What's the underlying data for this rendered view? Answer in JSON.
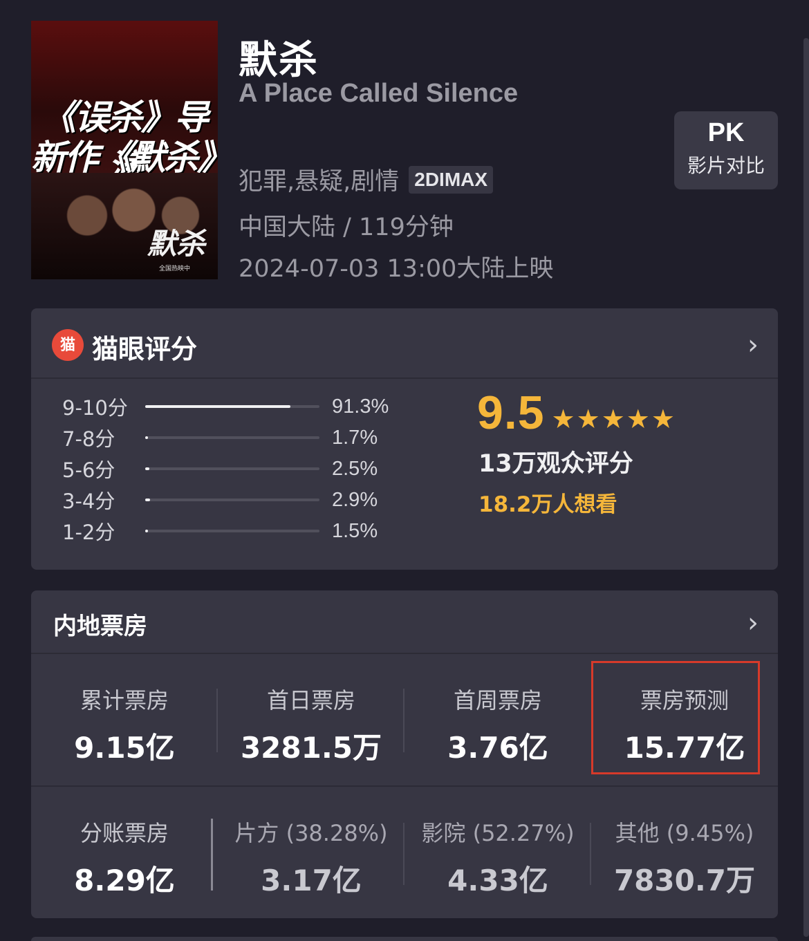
{
  "movie": {
    "title_cn": "默杀",
    "title_en": "A Place Called Silence",
    "genres": "犯罪,悬疑,剧情",
    "format": "2DIMAX",
    "region_duration": "中国大陆 / 119分钟",
    "release": "2024-07-03 13:00大陆上映",
    "poster": {
      "line1": "《误杀》导演",
      "line2": "新作《默杀》",
      "calligraphy": "默杀",
      "tag": "全国热映中"
    }
  },
  "pk": {
    "title": "PK",
    "subtitle": "影片对比"
  },
  "rating": {
    "title": "猫眼评分",
    "logo_icon": "cat-logo-icon",
    "logo_glyph": "猫",
    "chevron": "›",
    "distribution": [
      {
        "label": "9-10分",
        "percent": "91.3%",
        "fraction": 0.913
      },
      {
        "label": "7-8分",
        "percent": "1.7%",
        "fraction": 0.017
      },
      {
        "label": "5-6分",
        "percent": "2.5%",
        "fraction": 0.025
      },
      {
        "label": "3-4分",
        "percent": "2.9%",
        "fraction": 0.029
      },
      {
        "label": "1-2分",
        "percent": "1.5%",
        "fraction": 0.015
      }
    ],
    "score": "9.5",
    "stars": 5,
    "star_glyph": "★",
    "voters": "13万观众评分",
    "wish": "18.2万人想看",
    "accent_color": "#f5b63a"
  },
  "box_office": {
    "title": "内地票房",
    "chevron": "›",
    "row1": [
      {
        "label": "累计票房",
        "value": "9.15亿"
      },
      {
        "label": "首日票房",
        "value": "3281.5万"
      },
      {
        "label": "首周票房",
        "value": "3.76亿"
      },
      {
        "label": "票房预测",
        "value": "15.77亿"
      }
    ],
    "row2": [
      {
        "label": "分账票房",
        "value": "8.29亿"
      },
      {
        "label": "片方 (38.28%)",
        "value": "3.17亿"
      },
      {
        "label": "影院 (52.27%)",
        "value": "4.33亿"
      },
      {
        "label": "其他 (9.45%)",
        "value": "7830.7万"
      }
    ],
    "highlight_color": "#d63a2a"
  }
}
